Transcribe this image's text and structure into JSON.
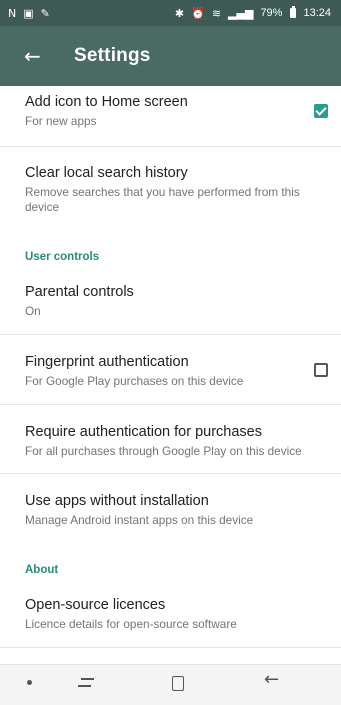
{
  "status_bar": {
    "left_icons": [
      "N",
      "▣",
      "✎"
    ],
    "right_icons": [
      "bluetooth-icon",
      "alarm-icon",
      "wifi-icon",
      "signal-icon"
    ],
    "battery": "79%",
    "time": "13:24"
  },
  "app_bar": {
    "back_glyph": "←",
    "title": "Settings"
  },
  "settings": {
    "home_icon": {
      "title": "Add icon to Home screen",
      "summary": "For new apps",
      "checked": true
    },
    "clear_history": {
      "title": "Clear local search history",
      "summary": "Remove searches that you have performed from this device"
    },
    "user_controls_header": "User controls",
    "parental": {
      "title": "Parental controls",
      "summary": "On"
    },
    "fingerprint": {
      "title": "Fingerprint authentication",
      "summary": "For Google Play purchases on this device",
      "checked": false
    },
    "require_auth": {
      "title": "Require authentication for purchases",
      "summary": "For all purchases through Google Play on this device"
    },
    "instant_apps": {
      "title": "Use apps without installation",
      "summary": "Manage Android instant apps on this device"
    },
    "about_header": "About",
    "licences": {
      "title": "Open-source licences",
      "summary": "Licence details for open-source software"
    }
  },
  "nav_bar": {
    "back_glyph": "←"
  },
  "colors": {
    "status_bar": "#3e5a55",
    "app_bar": "#4a6a64",
    "accent": "#2a9d8f",
    "section_header": "#2a8a7a"
  }
}
